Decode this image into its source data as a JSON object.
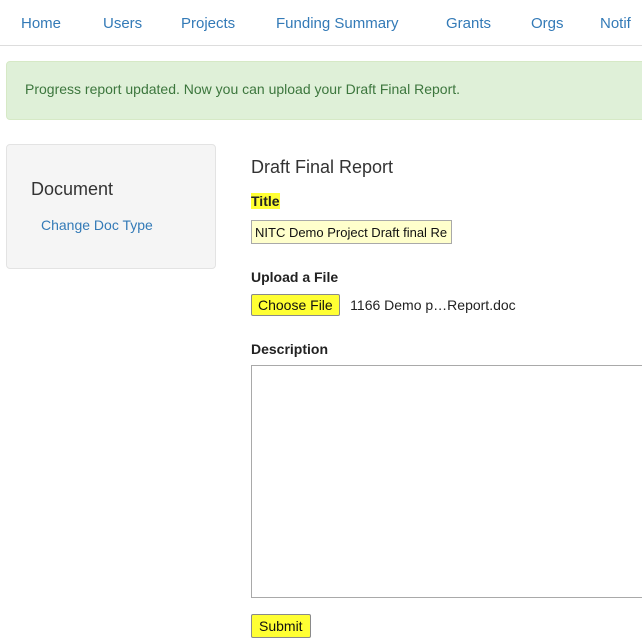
{
  "nav": {
    "items": [
      {
        "label": "Home"
      },
      {
        "label": "Users"
      },
      {
        "label": "Projects"
      },
      {
        "label": "Funding Summary"
      },
      {
        "label": "Grants"
      },
      {
        "label": "Orgs"
      },
      {
        "label": "Notif"
      }
    ]
  },
  "alert": {
    "message": "Progress report updated. Now you can upload your Draft Final Report."
  },
  "sidebar": {
    "title": "Document",
    "link": "Change Doc Type"
  },
  "form": {
    "heading": "Draft Final Report",
    "title_label": "Title",
    "title_value": "NITC Demo Project Draft final Report",
    "upload_label": "Upload a File",
    "choose_file_label": "Choose File",
    "file_name": "1166 Demo p…Report.doc",
    "description_label": "Description",
    "description_value": "",
    "submit_label": "Submit"
  },
  "colors": {
    "link": "#337ab7",
    "alert_bg": "#dff0d8",
    "alert_text": "#3c763d",
    "highlight": "#ffff33",
    "input_bg": "#ffffcc"
  }
}
